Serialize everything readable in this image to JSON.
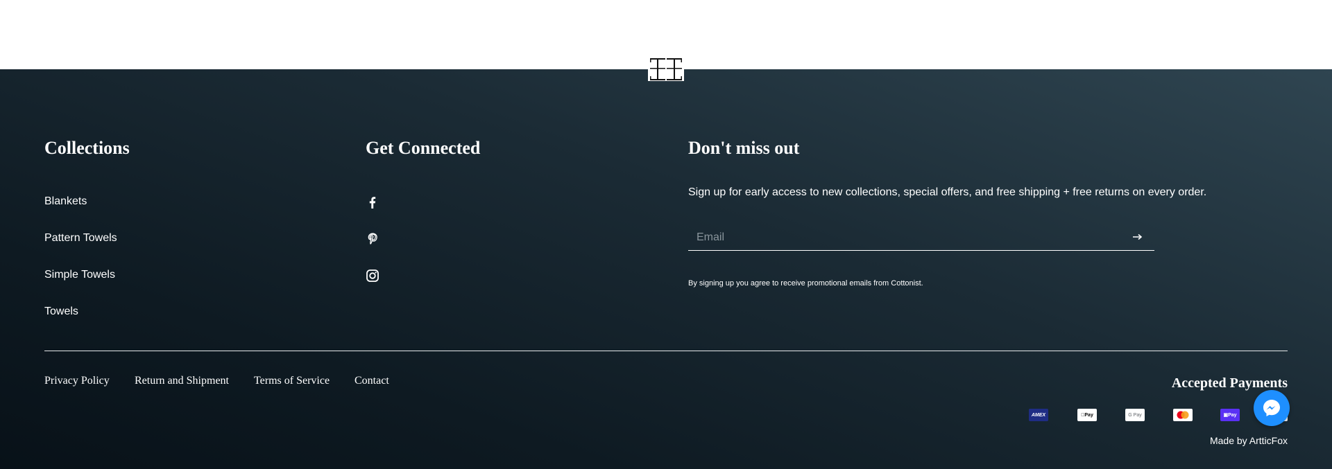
{
  "brand": {
    "logo_icon": "cottonist-logo"
  },
  "collections": {
    "title": "Collections",
    "items": [
      "Blankets",
      "Pattern Towels",
      "Simple Towels",
      "Towels"
    ]
  },
  "connected": {
    "title": "Get Connected",
    "icons": [
      "facebook-icon",
      "pinterest-icon",
      "instagram-icon"
    ]
  },
  "newsletter": {
    "title": "Don't miss out",
    "text": "Sign up for early access to new collections, special offers, and free shipping + free returns on every order.",
    "email_placeholder": "Email",
    "submit_icon": "arrow-right-icon",
    "fine_print": "By signing up you agree to receive promotional emails from Cottonist."
  },
  "legal_links": [
    "Privacy Policy",
    "Return and Shipment",
    "Terms of Service",
    "Contact"
  ],
  "payments": {
    "title": "Accepted Payments",
    "methods": [
      "amex",
      "apple-pay",
      "google-pay",
      "mastercard",
      "shop-pay",
      "visa"
    ]
  },
  "credit": "Made by ArtticFox",
  "chat": {
    "icon": "messenger-icon",
    "color": "#1e8fff"
  },
  "colors": {
    "footer_dark": "#0e1a22",
    "footer_light": "#2f4551",
    "text": "#ffffff"
  }
}
